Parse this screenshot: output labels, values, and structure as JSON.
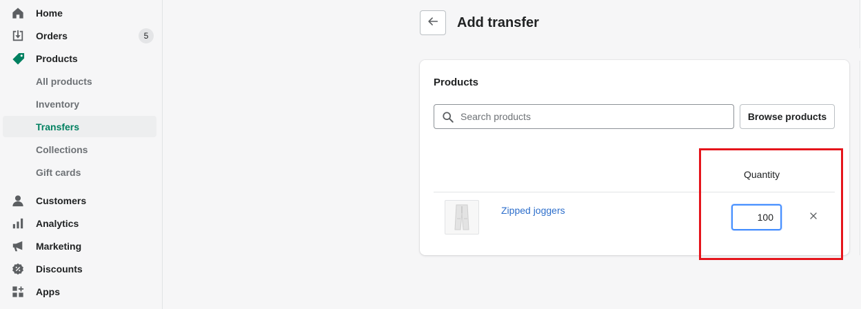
{
  "sidebar": {
    "items": [
      {
        "label": "Home",
        "icon": "home-icon"
      },
      {
        "label": "Orders",
        "icon": "orders-icon",
        "badge": "5"
      },
      {
        "label": "Products",
        "icon": "tag-icon"
      },
      {
        "label": "All products"
      },
      {
        "label": "Inventory"
      },
      {
        "label": "Transfers",
        "active": true
      },
      {
        "label": "Collections"
      },
      {
        "label": "Gift cards"
      },
      {
        "label": "Customers",
        "icon": "person-icon"
      },
      {
        "label": "Analytics",
        "icon": "analytics-icon"
      },
      {
        "label": "Marketing",
        "icon": "megaphone-icon"
      },
      {
        "label": "Discounts",
        "icon": "discount-icon"
      },
      {
        "label": "Apps",
        "icon": "apps-icon"
      }
    ]
  },
  "header": {
    "title": "Add transfer"
  },
  "card": {
    "title": "Products",
    "search": {
      "placeholder": "Search products",
      "value": ""
    },
    "browse_label": "Browse products",
    "columns": {
      "quantity": "Quantity"
    },
    "rows": [
      {
        "product": "Zipped joggers",
        "quantity": "100"
      }
    ]
  },
  "colors": {
    "accent": "#008060",
    "link": "#2c6ecb",
    "focus": "#458fff",
    "annotation": "#e5141b"
  }
}
